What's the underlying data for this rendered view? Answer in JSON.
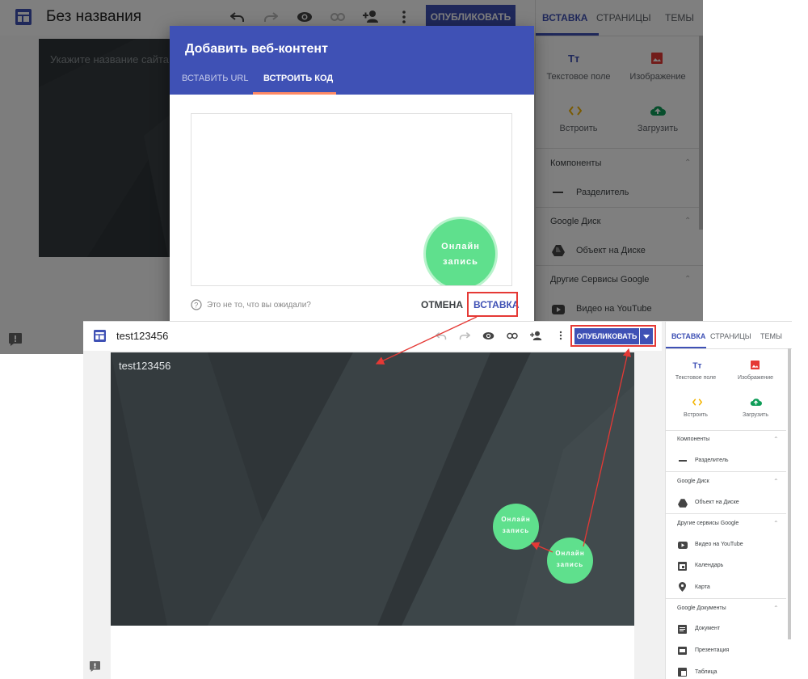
{
  "top": {
    "title": "Без названия",
    "site_name_placeholder": "Укажите название сайта",
    "publish_label": "ОПУБЛИКОВАТЬ",
    "tabs": [
      "ВСТАВКА",
      "СТРАНИЦЫ",
      "ТЕМЫ"
    ],
    "insert": {
      "text_box": "Текстовое поле",
      "image": "Изображение",
      "embed": "Встроить",
      "upload": "Загрузить"
    },
    "sections": {
      "components": "Компоненты",
      "divider": "Разделитель",
      "drive": "Google Диск",
      "drive_object": "Объект на Диске",
      "other": "Другие Сервисы Google",
      "youtube": "Видео на YouTube"
    },
    "dialog": {
      "title": "Добавить веб-контент",
      "tab_url": "ВСТАВИТЬ URL",
      "tab_code": "ВСТРОИТЬ КОД",
      "bubble": [
        "Онлайн",
        "запись"
      ],
      "hint": "Это не то, что вы ожидали?",
      "cancel": "ОТМЕНА",
      "insert": "ВСТАВКА"
    }
  },
  "bottom": {
    "title": "test123456",
    "hero_title": "test123456",
    "publish_label": "ОПУБЛИКОВАТЬ",
    "tabs": [
      "ВСТАВКА",
      "СТРАНИЦЫ",
      "ТЕМЫ"
    ],
    "insert": {
      "text_box": "Текстовое поле",
      "image": "Изображение",
      "embed": "Встроить",
      "upload": "Загрузить"
    },
    "sections": {
      "components": "Компоненты",
      "divider": "Разделитель",
      "drive": "Google Диск",
      "drive_object": "Объект на Диске",
      "other": "Другие сервисы Google",
      "youtube": "Видео на YouTube",
      "calendar": "Календарь",
      "map": "Карта",
      "docs": "Google Документы",
      "document": "Документ",
      "presentation": "Презентация",
      "table": "Таблица"
    },
    "bubble_a": [
      "Онлайн",
      "запись"
    ],
    "bubble_b": [
      "Онлайн",
      "запись"
    ]
  },
  "colors": {
    "primary": "#3f51b5",
    "accent_green": "#5fe08d",
    "annotation_red": "#e53935",
    "hero_dark": "#2f3538",
    "tab_underline": "#ff8a65"
  },
  "icons": [
    "sites-logo-icon",
    "undo-icon",
    "redo-icon",
    "preview-icon",
    "link-icon",
    "add-person-icon",
    "more-icon",
    "text-box-icon",
    "image-icon",
    "embed-icon",
    "upload-icon",
    "divider-icon",
    "drive-icon",
    "youtube-icon",
    "calendar-icon",
    "map-pin-icon",
    "document-icon",
    "presentation-icon",
    "table-icon",
    "feedback-icon",
    "help-icon"
  ]
}
